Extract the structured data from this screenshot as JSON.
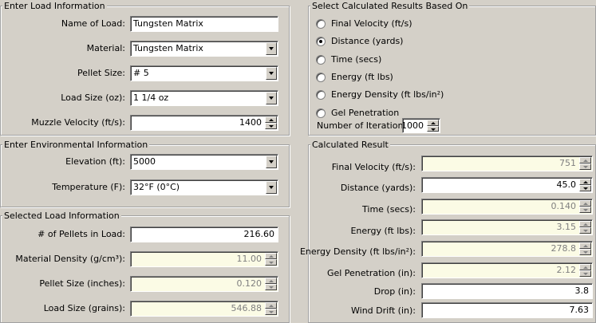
{
  "load_info": {
    "title": "Enter Load Information",
    "name_label": "Name of Load:",
    "name_value": "Tungsten Matrix",
    "material_label": "Material:",
    "material_value": "Tungsten Matrix",
    "pellet_label": "Pellet Size:",
    "pellet_value": "# 5",
    "load_size_label": "Load Size (oz):",
    "load_size_value": "1 1/4 oz",
    "muzzle_label": "Muzzle Velocity (ft/s):",
    "muzzle_value": "1400"
  },
  "env_info": {
    "title": "Enter Environmental Information",
    "elevation_label": "Elevation (ft):",
    "elevation_value": "5000",
    "temp_label": "Temperature (F):",
    "temp_value": "32°F (0°C)"
  },
  "selected_load": {
    "title": "Selected Load Information",
    "pellets_label": "# of Pellets in Load:",
    "pellets_value": "216.60",
    "density_label": "Material Density (g/cm³):",
    "density_value": "11.00",
    "pellet_inches_label": "Pellet Size (inches):",
    "pellet_inches_value": "0.120",
    "grains_label": "Load Size (grains):",
    "grains_value": "546.88"
  },
  "calc_select": {
    "title": "Select Calculated Results Based On",
    "options": [
      {
        "label": "Final Velocity (ft/s)",
        "selected": false
      },
      {
        "label": "Distance (yards)",
        "selected": true
      },
      {
        "label": "Time (secs)",
        "selected": false
      },
      {
        "label": "Energy (ft lbs)",
        "selected": false
      },
      {
        "label": "Energy Density (ft lbs/in²)",
        "selected": false
      },
      {
        "label": "Gel Penetration",
        "selected": false
      }
    ],
    "iterations_label": "Number of Iterations:",
    "iterations_value": "1000"
  },
  "result": {
    "title": "Calculated Result",
    "velocity_label": "Final Velocity (ft/s):",
    "velocity_value": "751",
    "distance_label": "Distance (yards):",
    "distance_value": "45.0",
    "time_label": "Time (secs):",
    "time_value": "0.140",
    "energy_label": "Energy (ft lbs):",
    "energy_value": "3.15",
    "edensity_label": "Energy Density (ft lbs/in²):",
    "edensity_value": "278.8",
    "gel_label": "Gel Penetration (in):",
    "gel_value": "2.12",
    "drop_label": "Drop (in):",
    "drop_value": "3.8",
    "drift_label": "Wind Drift (in):",
    "drift_value": "7.63"
  },
  "colors": {
    "window_bg": "#d4d0c8",
    "readonly_bg": "#fbfbe5",
    "readonly_text": "#808080"
  }
}
